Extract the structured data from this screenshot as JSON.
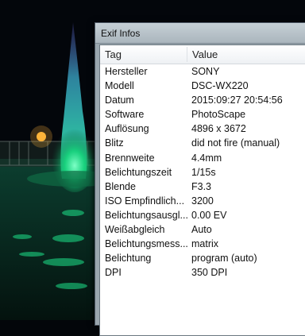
{
  "window": {
    "title": "Exif Infos"
  },
  "table": {
    "columns": [
      "Tag",
      "Value"
    ],
    "rows": [
      [
        "Hersteller",
        "SONY"
      ],
      [
        "Modell",
        "DSC-WX220"
      ],
      [
        "Datum",
        "2015:09:27 20:54:56"
      ],
      [
        "Software",
        "PhotoScape"
      ],
      [
        "Auflösung",
        "4896 x 3672"
      ],
      [
        "Blitz",
        "did not fire (manual)"
      ],
      [
        "Brennweite",
        "4.4mm"
      ],
      [
        "Belichtungszeit",
        "1/15s"
      ],
      [
        "Blende",
        "F3.3"
      ],
      [
        "ISO Empfindlich...",
        "3200"
      ],
      [
        "Belichtungsausgl...",
        "0.00 EV"
      ],
      [
        "Weißabgleich",
        "Auto"
      ],
      [
        "Belichtungsmess...",
        "matrix"
      ],
      [
        "Belichtung",
        "program (auto)"
      ],
      [
        "DPI",
        "350 DPI"
      ]
    ]
  },
  "colors": {
    "fountain": "#1de28a",
    "water_glow": "#0f6b45",
    "light": "#ffb43a"
  }
}
